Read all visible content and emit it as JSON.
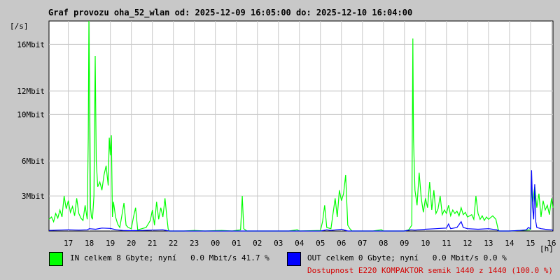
{
  "header": {
    "title": "Graf provozu oha_52_wlan od: 2025-12-09 16:05:00 do: 2025-12-10 16:04:00",
    "y_unit": "[/s]",
    "x_unit": "[h]"
  },
  "legend": {
    "in_text": "IN celkem 8 Gbyte; nyní   0.0 Mbit/s 41.7 %",
    "out_text": "OUT celkem 0 Gbyte; nyní   0.0 Mbit/s 0.0 %",
    "availability": "Dostupnost E220 KOMPAKTOR semik 1440 z 1440 (100.0 %)"
  },
  "colors": {
    "background": "#c8c8c8",
    "plot_bg": "#ffffff",
    "grid": "#c8c8c8",
    "in_series": "#00ff00",
    "out_series": "#0000ff",
    "availability_text": "#d40000"
  },
  "chart_data": {
    "type": "area",
    "title": "Graf provozu oha_52_wlan od: 2025-12-09 16:05:00 do: 2025-12-10 16:04:00",
    "ylabel": "[/s]",
    "xlabel": "[h]",
    "ylim": [
      0,
      18
    ],
    "ytick_values": [
      3,
      6,
      10,
      12,
      16
    ],
    "ytick_labels": [
      "3Mbit",
      "6Mbit",
      "10Mbit",
      "12Mbit",
      "16Mbit"
    ],
    "xtick_labels": [
      "17",
      "18",
      "19",
      "20",
      "21",
      "22",
      "23",
      "00",
      "01",
      "02",
      "03",
      "04",
      "05",
      "06",
      "07",
      "08",
      "09",
      "10",
      "11",
      "12",
      "13",
      "14",
      "15",
      "16"
    ],
    "xrange_hours": [
      16.08,
      40.07
    ],
    "grid": true,
    "series": [
      {
        "name": "IN",
        "color": "#00ff00",
        "points": [
          [
            16.08,
            1.0
          ],
          [
            16.2,
            1.2
          ],
          [
            16.3,
            0.8
          ],
          [
            16.4,
            1.5
          ],
          [
            16.5,
            1.1
          ],
          [
            16.6,
            1.8
          ],
          [
            16.7,
            1.2
          ],
          [
            16.8,
            3.0
          ],
          [
            16.9,
            1.9
          ],
          [
            17.0,
            2.6
          ],
          [
            17.1,
            1.6
          ],
          [
            17.2,
            2.1
          ],
          [
            17.3,
            1.3
          ],
          [
            17.4,
            2.8
          ],
          [
            17.5,
            1.5
          ],
          [
            17.6,
            1.1
          ],
          [
            17.7,
            0.9
          ],
          [
            17.8,
            2.2
          ],
          [
            17.9,
            1.0
          ],
          [
            17.95,
            8.0
          ],
          [
            17.98,
            18.0
          ],
          [
            18.02,
            11.0
          ],
          [
            18.06,
            2.0
          ],
          [
            18.1,
            1.2
          ],
          [
            18.15,
            1.0
          ],
          [
            18.22,
            3.0
          ],
          [
            18.28,
            15.0
          ],
          [
            18.33,
            6.0
          ],
          [
            18.4,
            3.8
          ],
          [
            18.5,
            4.2
          ],
          [
            18.6,
            3.5
          ],
          [
            18.7,
            4.8
          ],
          [
            18.8,
            5.6
          ],
          [
            18.9,
            3.9
          ],
          [
            18.95,
            8.0
          ],
          [
            19.0,
            6.5
          ],
          [
            19.05,
            8.2
          ],
          [
            19.1,
            1.2
          ],
          [
            19.15,
            2.5
          ],
          [
            19.25,
            1.2
          ],
          [
            19.35,
            0.6
          ],
          [
            19.45,
            0.3
          ],
          [
            19.5,
            0.8
          ],
          [
            19.65,
            2.4
          ],
          [
            19.75,
            0.5
          ],
          [
            19.85,
            0.3
          ],
          [
            20.0,
            0.2
          ],
          [
            20.1,
            1.2
          ],
          [
            20.2,
            2.0
          ],
          [
            20.3,
            0.1
          ],
          [
            20.5,
            0.2
          ],
          [
            20.7,
            0.3
          ],
          [
            20.9,
            0.9
          ],
          [
            21.0,
            1.8
          ],
          [
            21.1,
            0.5
          ],
          [
            21.2,
            2.5
          ],
          [
            21.3,
            1.0
          ],
          [
            21.4,
            2.0
          ],
          [
            21.5,
            1.2
          ],
          [
            21.6,
            2.8
          ],
          [
            21.7,
            1.0
          ],
          [
            21.75,
            0.2
          ],
          [
            21.8,
            0.0
          ],
          [
            22.5,
            0.0
          ],
          [
            23.0,
            0.05
          ],
          [
            23.5,
            0.0
          ],
          [
            24.3,
            0.05
          ],
          [
            24.8,
            0.0
          ],
          [
            25.2,
            0.1
          ],
          [
            25.28,
            3.0
          ],
          [
            25.35,
            0.2
          ],
          [
            25.5,
            0.0
          ],
          [
            27.5,
            0.0
          ],
          [
            27.9,
            0.1
          ],
          [
            28.0,
            0.0
          ],
          [
            29.0,
            0.05
          ],
          [
            29.1,
            0.8
          ],
          [
            29.2,
            2.2
          ],
          [
            29.3,
            0.3
          ],
          [
            29.5,
            0.2
          ],
          [
            29.6,
            1.5
          ],
          [
            29.7,
            2.8
          ],
          [
            29.8,
            1.2
          ],
          [
            29.9,
            3.5
          ],
          [
            30.0,
            2.6
          ],
          [
            30.1,
            3.2
          ],
          [
            30.2,
            4.8
          ],
          [
            30.3,
            0.5
          ],
          [
            30.4,
            0.2
          ],
          [
            30.5,
            0.0
          ],
          [
            31.5,
            0.0
          ],
          [
            31.9,
            0.1
          ],
          [
            32.0,
            0.0
          ],
          [
            33.0,
            0.0
          ],
          [
            33.2,
            0.1
          ],
          [
            33.35,
            0.5
          ],
          [
            33.4,
            16.5
          ],
          [
            33.43,
            8.0
          ],
          [
            33.5,
            3.5
          ],
          [
            33.6,
            2.2
          ],
          [
            33.7,
            5.0
          ],
          [
            33.8,
            2.8
          ],
          [
            33.9,
            1.6
          ],
          [
            34.0,
            2.8
          ],
          [
            34.1,
            2.0
          ],
          [
            34.2,
            4.2
          ],
          [
            34.3,
            1.8
          ],
          [
            34.4,
            3.5
          ],
          [
            34.5,
            1.5
          ],
          [
            34.6,
            1.9
          ],
          [
            34.7,
            3.0
          ],
          [
            34.8,
            1.4
          ],
          [
            34.9,
            1.8
          ],
          [
            35.0,
            1.5
          ],
          [
            35.1,
            2.2
          ],
          [
            35.2,
            1.3
          ],
          [
            35.3,
            1.8
          ],
          [
            35.4,
            1.5
          ],
          [
            35.5,
            1.7
          ],
          [
            35.6,
            1.3
          ],
          [
            35.7,
            2.0
          ],
          [
            35.8,
            1.4
          ],
          [
            35.9,
            1.6
          ],
          [
            36.0,
            1.2
          ],
          [
            36.2,
            1.4
          ],
          [
            36.3,
            1.0
          ],
          [
            36.4,
            3.0
          ],
          [
            36.5,
            1.5
          ],
          [
            36.6,
            1.0
          ],
          [
            36.7,
            1.3
          ],
          [
            36.8,
            0.9
          ],
          [
            36.9,
            1.2
          ],
          [
            37.0,
            1.0
          ],
          [
            37.2,
            1.3
          ],
          [
            37.35,
            1.0
          ],
          [
            37.45,
            0.2
          ],
          [
            37.5,
            0.0
          ],
          [
            38.0,
            0.0
          ],
          [
            38.5,
            0.05
          ],
          [
            39.0,
            0.1
          ],
          [
            39.05,
            4.0
          ],
          [
            39.1,
            2.5
          ],
          [
            39.2,
            3.8
          ],
          [
            39.3,
            2.0
          ],
          [
            39.4,
            3.2
          ],
          [
            39.5,
            1.2
          ],
          [
            39.6,
            2.6
          ],
          [
            39.7,
            1.8
          ],
          [
            39.8,
            2.2
          ],
          [
            39.9,
            1.4
          ],
          [
            40.0,
            2.8
          ],
          [
            40.07,
            2.0
          ]
        ]
      },
      {
        "name": "OUT",
        "color": "#0000ff",
        "points": [
          [
            16.08,
            0.05
          ],
          [
            16.5,
            0.08
          ],
          [
            17.0,
            0.1
          ],
          [
            17.5,
            0.08
          ],
          [
            17.9,
            0.1
          ],
          [
            18.0,
            0.2
          ],
          [
            18.3,
            0.15
          ],
          [
            18.6,
            0.25
          ],
          [
            19.0,
            0.22
          ],
          [
            19.3,
            0.1
          ],
          [
            19.6,
            0.05
          ],
          [
            20.0,
            0.03
          ],
          [
            20.5,
            0.05
          ],
          [
            21.0,
            0.08
          ],
          [
            21.5,
            0.1
          ],
          [
            21.8,
            0.0
          ],
          [
            22.0,
            0.0
          ],
          [
            24.0,
            0.0
          ],
          [
            27.0,
            0.0
          ],
          [
            29.0,
            0.0
          ],
          [
            29.3,
            0.1
          ],
          [
            29.5,
            0.05
          ],
          [
            30.0,
            0.15
          ],
          [
            30.3,
            0.0
          ],
          [
            33.0,
            0.0
          ],
          [
            33.3,
            0.1
          ],
          [
            33.5,
            0.08
          ],
          [
            34.0,
            0.15
          ],
          [
            34.5,
            0.2
          ],
          [
            35.0,
            0.25
          ],
          [
            35.1,
            0.6
          ],
          [
            35.2,
            0.2
          ],
          [
            35.5,
            0.3
          ],
          [
            35.7,
            0.8
          ],
          [
            35.8,
            0.3
          ],
          [
            36.0,
            0.2
          ],
          [
            36.5,
            0.15
          ],
          [
            37.0,
            0.2
          ],
          [
            37.4,
            0.1
          ],
          [
            37.5,
            0.0
          ],
          [
            38.0,
            0.0
          ],
          [
            38.5,
            0.05
          ],
          [
            38.8,
            0.1
          ],
          [
            38.9,
            0.3
          ],
          [
            39.0,
            0.2
          ],
          [
            39.05,
            5.2
          ],
          [
            39.1,
            2.0
          ],
          [
            39.15,
            1.0
          ],
          [
            39.2,
            4.0
          ],
          [
            39.25,
            0.8
          ],
          [
            39.3,
            0.3
          ],
          [
            39.5,
            0.2
          ],
          [
            39.7,
            0.15
          ],
          [
            40.0,
            0.1
          ],
          [
            40.07,
            0.05
          ]
        ]
      }
    ]
  }
}
